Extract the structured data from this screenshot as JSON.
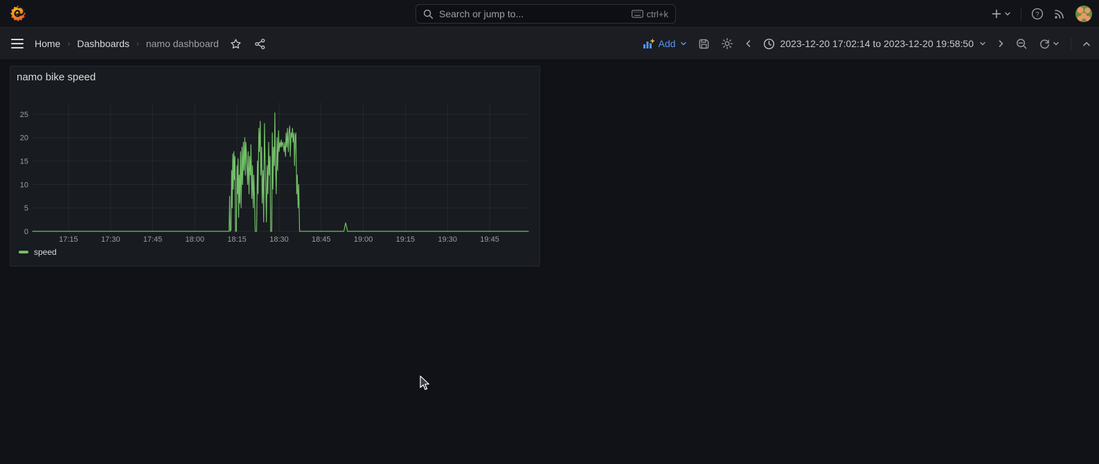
{
  "topbar": {
    "search": {
      "placeholder": "Search or jump to...",
      "shortcut": "ctrl+k"
    }
  },
  "toolbar": {
    "breadcrumbs": [
      {
        "label": "Home"
      },
      {
        "label": "Dashboards"
      },
      {
        "label": "namo dashboard"
      }
    ],
    "add_label": "Add",
    "time_range": "2023-12-20 17:02:14 to 2023-12-20 19:58:50"
  },
  "panel": {
    "title": "namo bike speed",
    "legend": [
      {
        "label": "speed",
        "color": "#73bf69"
      }
    ]
  },
  "chart_data": {
    "type": "line",
    "title": "namo bike speed",
    "x_unit": "minutes after 17:00 (time of day)",
    "x_range_minutes": [
      2.2,
      178.8
    ],
    "y_axis_max": 27.5,
    "y_ticks": [
      0,
      5,
      10,
      15,
      20,
      25
    ],
    "x_ticks": {
      "minutes": [
        15,
        30,
        45,
        60,
        75,
        90,
        105,
        120,
        135,
        150,
        165
      ],
      "labels": [
        "17:15",
        "17:30",
        "17:45",
        "18:00",
        "18:15",
        "18:30",
        "18:45",
        "19:00",
        "19:15",
        "19:30",
        "19:45"
      ]
    },
    "grid": true,
    "legend_position": "bottom-left",
    "series": [
      {
        "name": "speed",
        "color": "#73bf69",
        "points": [
          [
            2.2,
            0
          ],
          [
            40,
            0
          ],
          [
            70,
            0
          ],
          [
            72.2,
            0
          ],
          [
            72.4,
            7.5
          ],
          [
            72.6,
            0
          ],
          [
            72.9,
            0.3
          ],
          [
            73.1,
            13
          ],
          [
            73.3,
            5
          ],
          [
            73.5,
            16.5
          ],
          [
            73.7,
            9
          ],
          [
            73.9,
            17
          ],
          [
            74.1,
            11
          ],
          [
            74.3,
            16
          ],
          [
            74.5,
            0
          ],
          [
            74.8,
            0
          ],
          [
            75.0,
            14
          ],
          [
            75.2,
            8
          ],
          [
            75.4,
            15.5
          ],
          [
            75.6,
            3
          ],
          [
            75.8,
            12
          ],
          [
            76.0,
            6
          ],
          [
            76.3,
            17
          ],
          [
            76.5,
            5
          ],
          [
            76.8,
            18
          ],
          [
            77.0,
            10
          ],
          [
            77.3,
            19
          ],
          [
            77.5,
            13
          ],
          [
            77.8,
            20
          ],
          [
            78.0,
            12
          ],
          [
            78.2,
            19
          ],
          [
            78.5,
            15
          ],
          [
            78.8,
            10
          ],
          [
            79.0,
            17
          ],
          [
            79.3,
            8
          ],
          [
            79.5,
            16
          ],
          [
            79.8,
            12
          ],
          [
            80.0,
            18.5
          ],
          [
            80.3,
            7
          ],
          [
            80.5,
            14
          ],
          [
            80.8,
            5
          ],
          [
            81.0,
            12
          ],
          [
            81.3,
            6
          ],
          [
            81.5,
            0
          ],
          [
            82.0,
            0
          ],
          [
            82.3,
            15
          ],
          [
            82.5,
            8
          ],
          [
            82.8,
            22
          ],
          [
            83.0,
            17
          ],
          [
            83.3,
            23.5
          ],
          [
            83.5,
            12
          ],
          [
            83.8,
            18
          ],
          [
            84.0,
            6
          ],
          [
            84.3,
            13
          ],
          [
            84.5,
            2
          ],
          [
            84.8,
            23
          ],
          [
            85.0,
            16
          ],
          [
            85.3,
            9
          ],
          [
            85.5,
            2
          ],
          [
            85.8,
            14
          ],
          [
            86.0,
            8
          ],
          [
            86.3,
            19
          ],
          [
            86.5,
            12
          ],
          [
            86.8,
            16
          ],
          [
            87.0,
            0
          ],
          [
            87.4,
            0
          ],
          [
            87.6,
            21
          ],
          [
            87.8,
            9
          ],
          [
            88.0,
            18
          ],
          [
            88.3,
            14
          ],
          [
            88.5,
            25.3
          ],
          [
            88.7,
            15
          ],
          [
            89.0,
            8
          ],
          [
            89.3,
            20
          ],
          [
            89.5,
            13
          ],
          [
            89.8,
            21.5
          ],
          [
            90.0,
            17
          ],
          [
            90.3,
            19
          ],
          [
            90.5,
            18
          ],
          [
            90.8,
            19.5
          ],
          [
            91.0,
            18
          ],
          [
            91.3,
            19
          ],
          [
            91.5,
            18.5
          ],
          [
            91.8,
            17
          ],
          [
            92.0,
            19
          ],
          [
            92.3,
            16
          ],
          [
            92.5,
            21
          ],
          [
            92.8,
            18
          ],
          [
            93.0,
            22
          ],
          [
            93.3,
            17
          ],
          [
            93.5,
            21
          ],
          [
            93.8,
            22.5
          ],
          [
            94.0,
            16
          ],
          [
            94.3,
            21
          ],
          [
            94.5,
            20
          ],
          [
            94.8,
            22
          ],
          [
            95.0,
            19
          ],
          [
            95.3,
            21
          ],
          [
            95.5,
            14
          ],
          [
            95.8,
            20.5
          ],
          [
            96.0,
            21
          ],
          [
            96.3,
            8
          ],
          [
            96.5,
            12
          ],
          [
            96.8,
            5
          ],
          [
            97.0,
            10
          ],
          [
            97.3,
            0
          ],
          [
            98.3,
            0
          ],
          [
            110,
            0
          ],
          [
            113.1,
            0
          ],
          [
            113.7,
            1.8
          ],
          [
            114.4,
            0
          ],
          [
            130,
            0
          ],
          [
            150,
            0
          ],
          [
            178.8,
            0
          ]
        ]
      }
    ]
  },
  "colors": {
    "series_green": "#73bf69",
    "link_blue": "#5794f2",
    "canvas_bg": "#111217",
    "panel_bg": "#181b1f",
    "toolbar_bg": "#1b1d22",
    "topbar_bg": "#121318",
    "grid_line": "rgba(204,204,220,0.08)",
    "axis_text": "#9d9fa5"
  }
}
